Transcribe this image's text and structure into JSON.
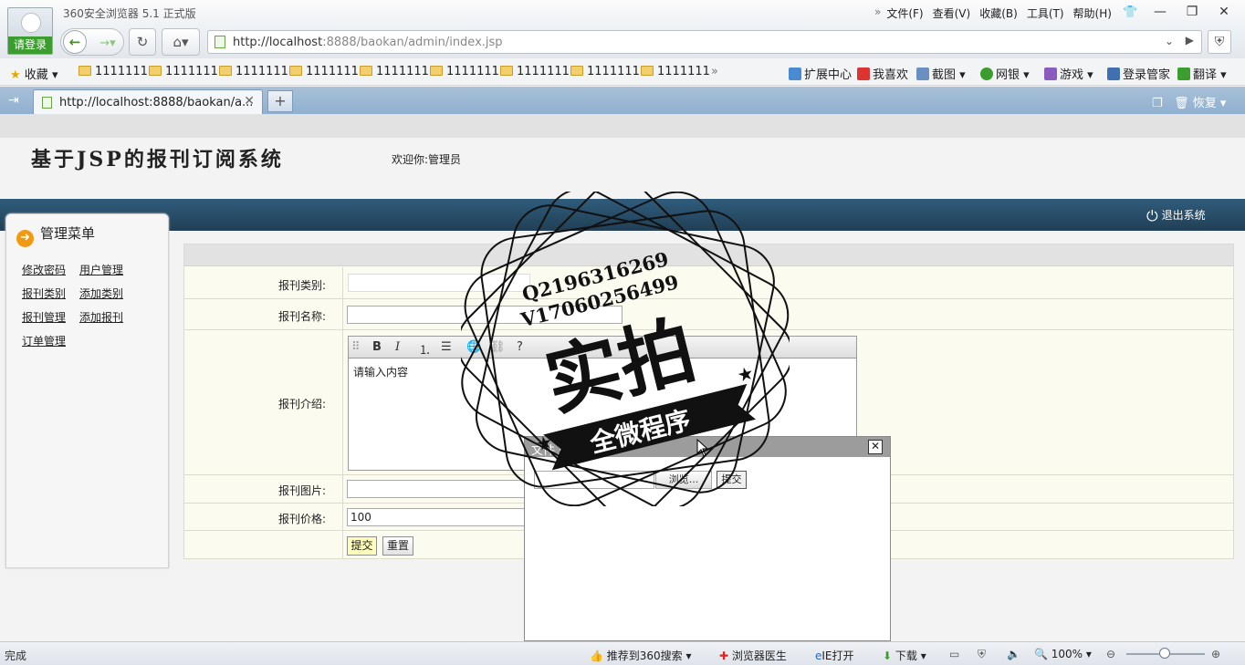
{
  "browser": {
    "login_label": "请登录",
    "title": "360安全浏览器 5.1 正式版",
    "menu": [
      "文件(F)",
      "查看(V)",
      "收藏(B)",
      "工具(T)",
      "帮助(H)"
    ],
    "address_host": "http://localhost",
    "address_rest": ":8888/baokan/admin/index.jsp",
    "favorites_label": "收藏",
    "bookmarks": [
      "1111111",
      "1111111",
      "1111111",
      "1111111",
      "1111111",
      "1111111",
      "1111111",
      "1111111",
      "1111111"
    ],
    "right_tools": [
      "扩展中心",
      "我喜欢",
      "截图",
      "网银",
      "游戏",
      "登录管家",
      "翻译"
    ],
    "tab_title": "http://localhost:8888/baokan/a...",
    "restore_label": "恢复"
  },
  "page": {
    "title": "基于JSP的报刊订阅系统",
    "welcome": "欢迎你:管理员",
    "logout_label": "退出系统"
  },
  "menu": {
    "title": "管理菜单",
    "links": [
      "修改密码",
      "用户管理",
      "报刊类别",
      "添加类别",
      "报刊管理",
      "添加报刊",
      "订单管理"
    ]
  },
  "form": {
    "labels": {
      "category": "报刊类别:",
      "name": "报刊名称:",
      "intro": "报刊介绍:",
      "image": "报刊图片:",
      "price": "报刊价格:"
    },
    "editor_placeholder": "请输入内容",
    "price_value": "100",
    "name_value": "",
    "image_value": "",
    "submit_label": "提交",
    "reset_label": "重置"
  },
  "upload_dialog": {
    "title": "文件上传",
    "browse_label": "浏览...",
    "submit_label": "提交"
  },
  "watermark": {
    "line1": "Q2196316269",
    "line2": "V17060256499",
    "big_text": "实拍",
    "ribbon_text": "全微程序"
  },
  "statusbar": {
    "status": "完成",
    "items": [
      "推荐到360搜索",
      "浏览器医生",
      "IE打开",
      "下载"
    ],
    "zoom": "100%"
  }
}
